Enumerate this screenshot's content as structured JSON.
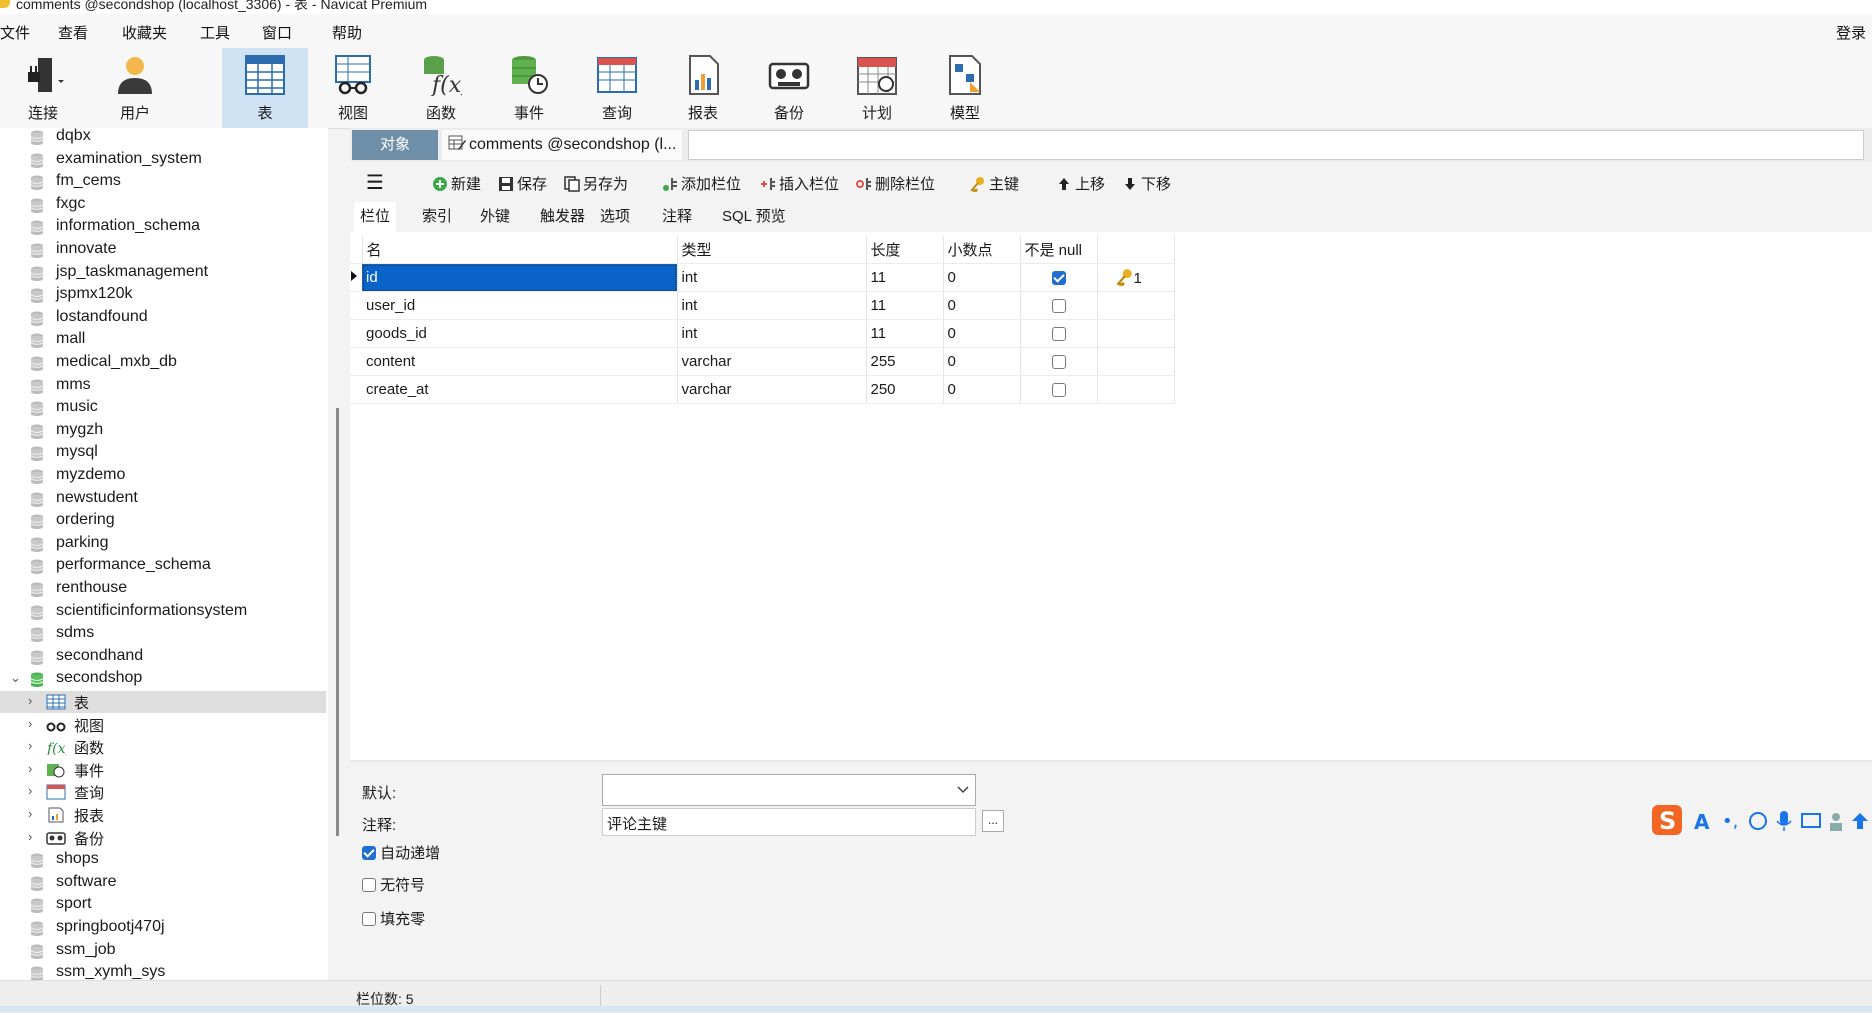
{
  "window": {
    "title": "comments @secondshop (localhost_3306) - 表 - Navicat Premium",
    "login": "登录"
  },
  "menu": [
    "文件",
    "查看",
    "收藏夹",
    "工具",
    "窗口",
    "帮助"
  ],
  "toolbar": [
    {
      "label": "连接",
      "icon": "plug-icon"
    },
    {
      "label": "用户",
      "icon": "user-icon"
    },
    {
      "label": "表",
      "icon": "table-icon"
    },
    {
      "label": "视图",
      "icon": "view-icon"
    },
    {
      "label": "函数",
      "icon": "function-icon"
    },
    {
      "label": "事件",
      "icon": "event-icon"
    },
    {
      "label": "查询",
      "icon": "query-icon"
    },
    {
      "label": "报表",
      "icon": "report-icon"
    },
    {
      "label": "备份",
      "icon": "backup-icon"
    },
    {
      "label": "计划",
      "icon": "schedule-icon"
    },
    {
      "label": "模型",
      "icon": "model-icon"
    }
  ],
  "sidebar": {
    "databases_top": [
      "dqbx",
      "examination_system",
      "fm_cems",
      "fxgc",
      "information_schema",
      "innovate",
      "jsp_taskmanagement",
      "jspmx120k",
      "lostandfound",
      "mall",
      "medical_mxb_db",
      "mms",
      "music",
      "mygzh",
      "mysql",
      "myzdemo",
      "newstudent",
      "ordering",
      "parking",
      "performance_schema",
      "renthouse",
      "scientificinformationsystem",
      "sdms",
      "secondhand"
    ],
    "open_db": "secondshop",
    "children": [
      "表",
      "视图",
      "函数",
      "事件",
      "查询",
      "报表",
      "备份"
    ],
    "databases_bottom": [
      "shops",
      "software",
      "sport",
      "springbootj470j",
      "ssm_job",
      "ssm_xymh_sys"
    ]
  },
  "tabs": {
    "object": "对象",
    "doc": "comments @secondshop (l..."
  },
  "edit_toolbar": {
    "new": "新建",
    "save": "保存",
    "save_as": "另存为",
    "add_field": "添加栏位",
    "insert_field": "插入栏位",
    "delete_field": "删除栏位",
    "primary_key": "主键",
    "move_up": "上移",
    "move_down": "下移"
  },
  "subtabs": [
    "栏位",
    "索引",
    "外键",
    "触发器",
    "选项",
    "注释",
    "SQL 预览"
  ],
  "grid": {
    "headers": [
      "名",
      "类型",
      "长度",
      "小数点",
      "不是 null",
      ""
    ],
    "rows": [
      {
        "name": "id",
        "type": "int",
        "length": "11",
        "decimal": "0",
        "notnull": true,
        "key": "1"
      },
      {
        "name": "user_id",
        "type": "int",
        "length": "11",
        "decimal": "0",
        "notnull": false,
        "key": ""
      },
      {
        "name": "goods_id",
        "type": "int",
        "length": "11",
        "decimal": "0",
        "notnull": false,
        "key": ""
      },
      {
        "name": "content",
        "type": "varchar",
        "length": "255",
        "decimal": "0",
        "notnull": false,
        "key": ""
      },
      {
        "name": "create_at",
        "type": "varchar",
        "length": "250",
        "decimal": "0",
        "notnull": false,
        "key": ""
      }
    ]
  },
  "props": {
    "default_label": "默认:",
    "default_value": "",
    "comment_label": "注释:",
    "comment_value": "评论主键",
    "more": "...",
    "auto_increment": "自动递增",
    "auto_increment_checked": true,
    "unsigned": "无符号",
    "unsigned_checked": false,
    "zerofill": "填充零",
    "zerofill_checked": false
  },
  "status": {
    "field_count": "栏位数: 5"
  },
  "colors": {
    "selection": "#0a63c8",
    "tab_active": "#6f8fa9",
    "toolbar_active": "#cfe3f5"
  }
}
